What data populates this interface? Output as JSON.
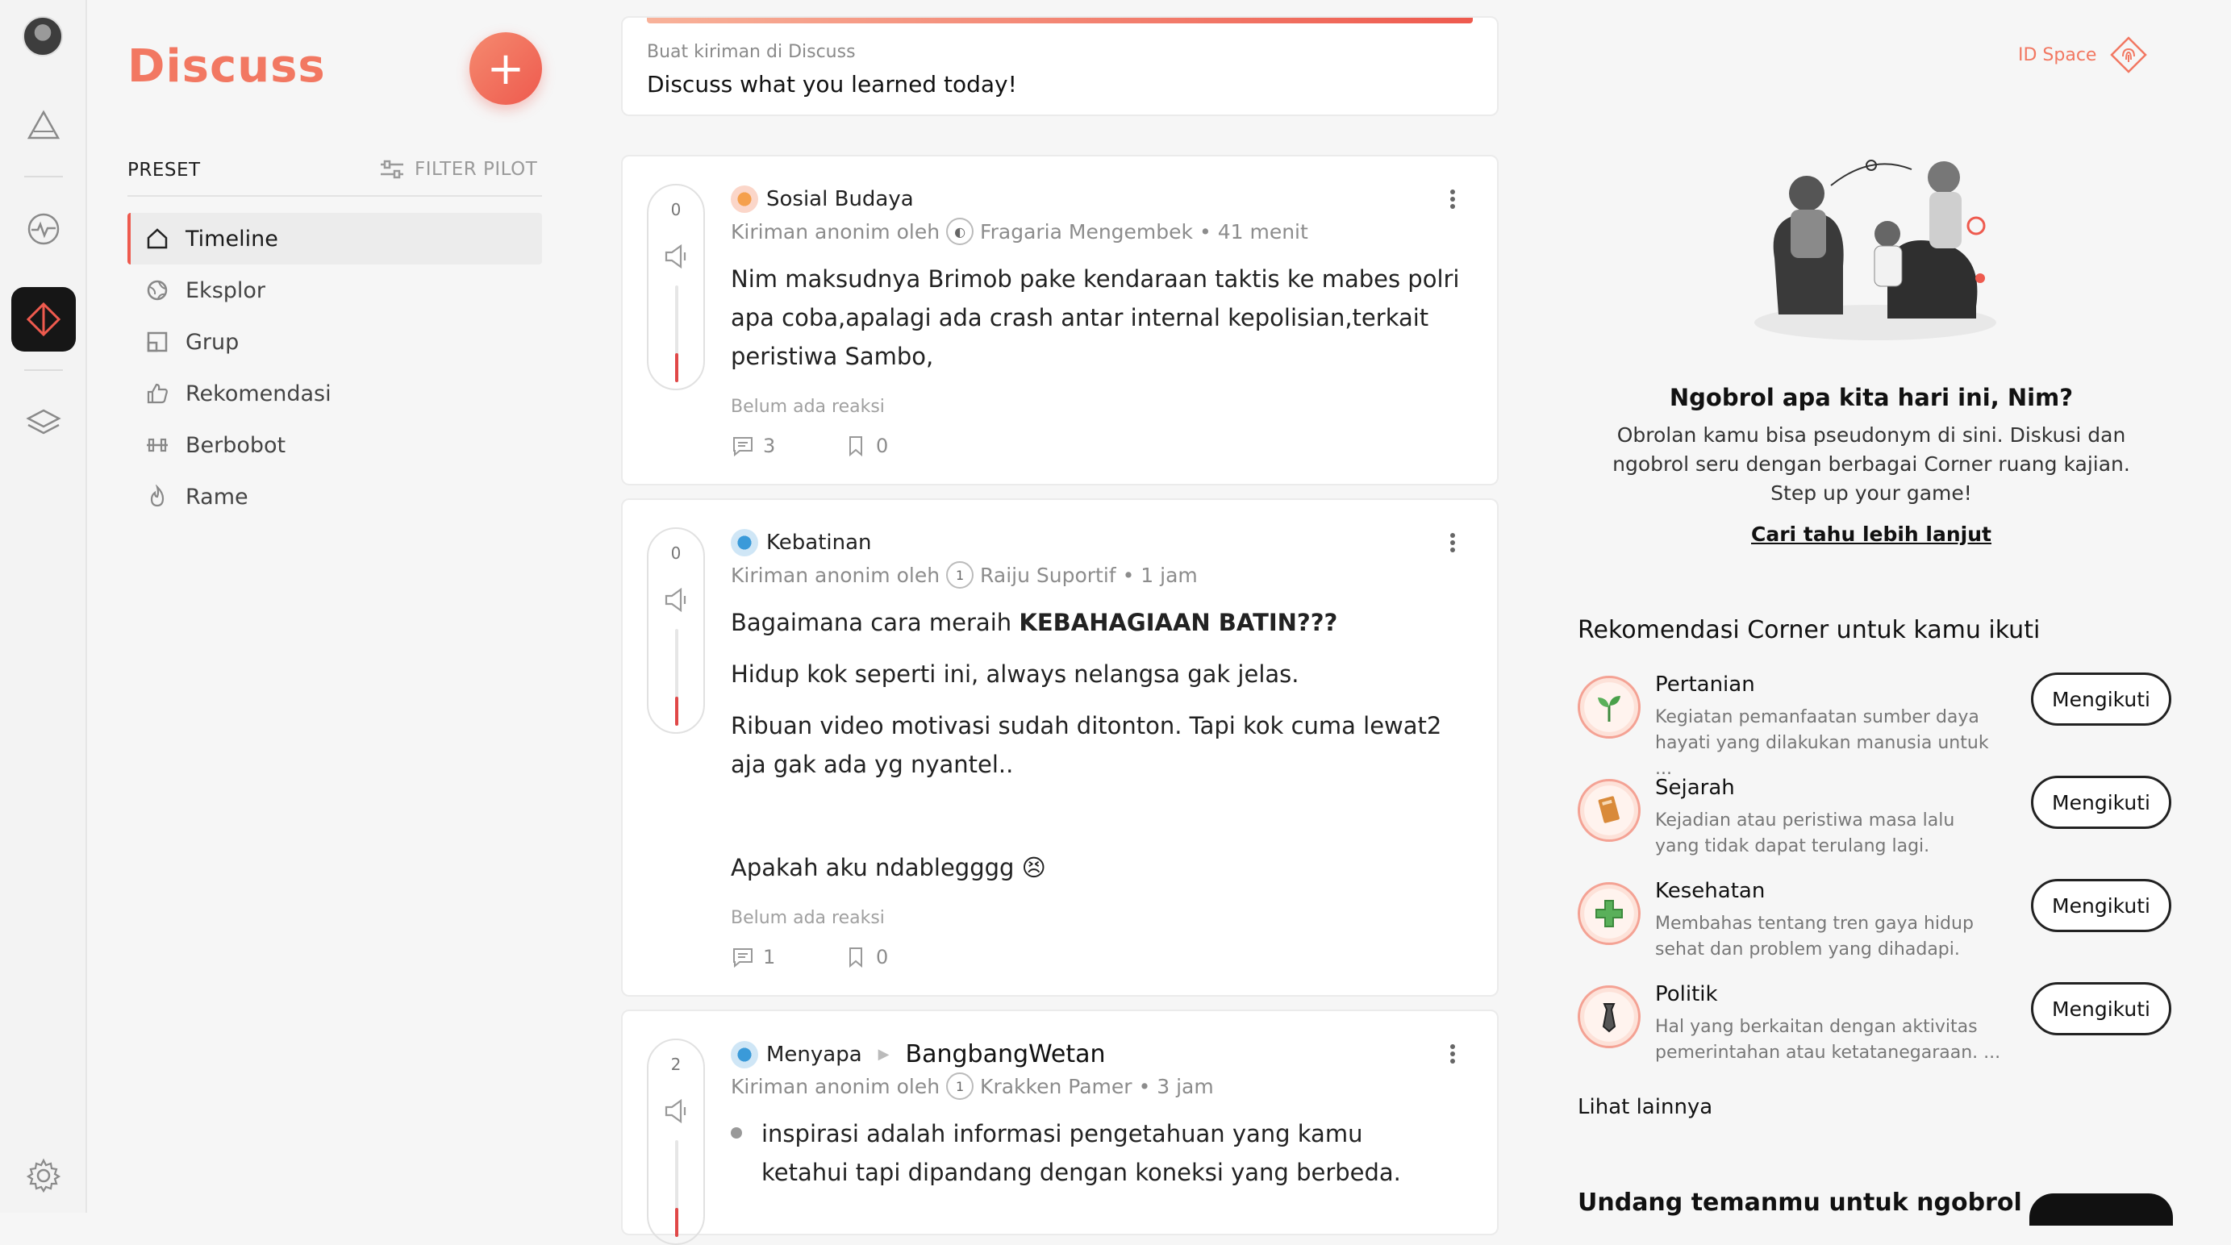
{
  "app": {
    "brand": "Discuss"
  },
  "rail": {
    "items": [
      "avatar",
      "triangle-icon",
      "wave-icon",
      "diamond-icon",
      "layers-icon",
      "settings-icon"
    ],
    "active": "diamond-icon"
  },
  "left": {
    "preset_label": "PRESET",
    "filter_label": "FILTER PILOT",
    "nav": [
      {
        "label": "Timeline",
        "icon": "home-icon",
        "active": true
      },
      {
        "label": "Eksplor",
        "icon": "globe-icon"
      },
      {
        "label": "Grup",
        "icon": "group-icon"
      },
      {
        "label": "Rekomendasi",
        "icon": "thumbs-up-icon"
      },
      {
        "label": "Berbobot",
        "icon": "dumbbell-icon"
      },
      {
        "label": "Rame",
        "icon": "flame-icon"
      }
    ]
  },
  "compose": {
    "sub": "Buat kiriman di Discuss",
    "prompt": "Discuss what you learned today!"
  },
  "posts": [
    {
      "votes": "0",
      "vote_level": 0.3,
      "corner": "Sosial Budaya",
      "meta_prefix": "Kiriman anonim oleh",
      "author": "Fragaria Mengembek",
      "time": "• 41 menit",
      "paragraphs": [
        "Nim maksudnya Brimob pake kendaraan taktis ke mabes polri apa coba,apalagi ada crash antar internal kepolisian,terkait peristiwa Sambo,"
      ],
      "reactions": "Belum ada reaksi",
      "comments": "3",
      "bookmarks": "0"
    },
    {
      "votes": "0",
      "vote_level": 0.3,
      "corner": "Kebatinan",
      "meta_prefix": "Kiriman anonim oleh",
      "author": "Raiju Suportif",
      "time": "• 1 jam",
      "title_prefix": "Bagaimana cara meraih ",
      "title_bold": "KEBAHAGIAAN BATIN???",
      "paragraphs": [
        "Hidup kok seperti ini, always nelangsa gak jelas.",
        "Ribuan video motivasi sudah ditonton. Tapi kok cuma lewat2 aja gak ada yg nyantel..",
        "Apakah aku ndablegggg 😣"
      ],
      "reactions": "Belum ada reaksi",
      "comments": "1",
      "bookmarks": "0"
    },
    {
      "votes": "2",
      "vote_level": 0.3,
      "corner": "Menyapa",
      "target": "BangbangWetan",
      "meta_prefix": "Kiriman anonim oleh",
      "author": "Krakken Pamer",
      "time": "• 3 jam",
      "bullet": "inspirasi adalah informasi pengetahuan yang kamu ketahui tapi dipandang dengan koneksi yang berbeda."
    }
  ],
  "right": {
    "id_space": "ID Space",
    "title": "Ngobrol apa kita hari ini, Nim?",
    "body": "Obrolan kamu bisa pseudonym di sini. Diskusi dan ngobrol seru dengan berbagai Corner ruang kajian. Step up your game!",
    "link": "Cari tahu lebih lanjut",
    "rec_title": "Rekomendasi Corner untuk kamu ikuti",
    "recs": [
      {
        "name": "Pertanian",
        "desc": "Kegiatan pemanfaatan sumber daya hayati yang dilakukan manusia untuk ...",
        "button": "Mengikuti",
        "icon": "sprout-icon"
      },
      {
        "name": "Sejarah",
        "desc": "Kejadian atau peristiwa masa lalu yang tidak dapat terulang lagi.",
        "button": "Mengikuti",
        "icon": "book-icon"
      },
      {
        "name": "Kesehatan",
        "desc": "Membahas tentang tren gaya hidup sehat dan problem yang dihadapi.",
        "button": "Mengikuti",
        "icon": "medical-cross-icon"
      },
      {
        "name": "Politik",
        "desc": "Hal yang berkaitan dengan aktivitas pemerintahan atau ketatanegaraan. ...",
        "button": "Mengikuti",
        "icon": "tie-icon"
      }
    ],
    "see_more": "Lihat lainnya",
    "invite": "Undang temanmu untuk ngobrol"
  }
}
